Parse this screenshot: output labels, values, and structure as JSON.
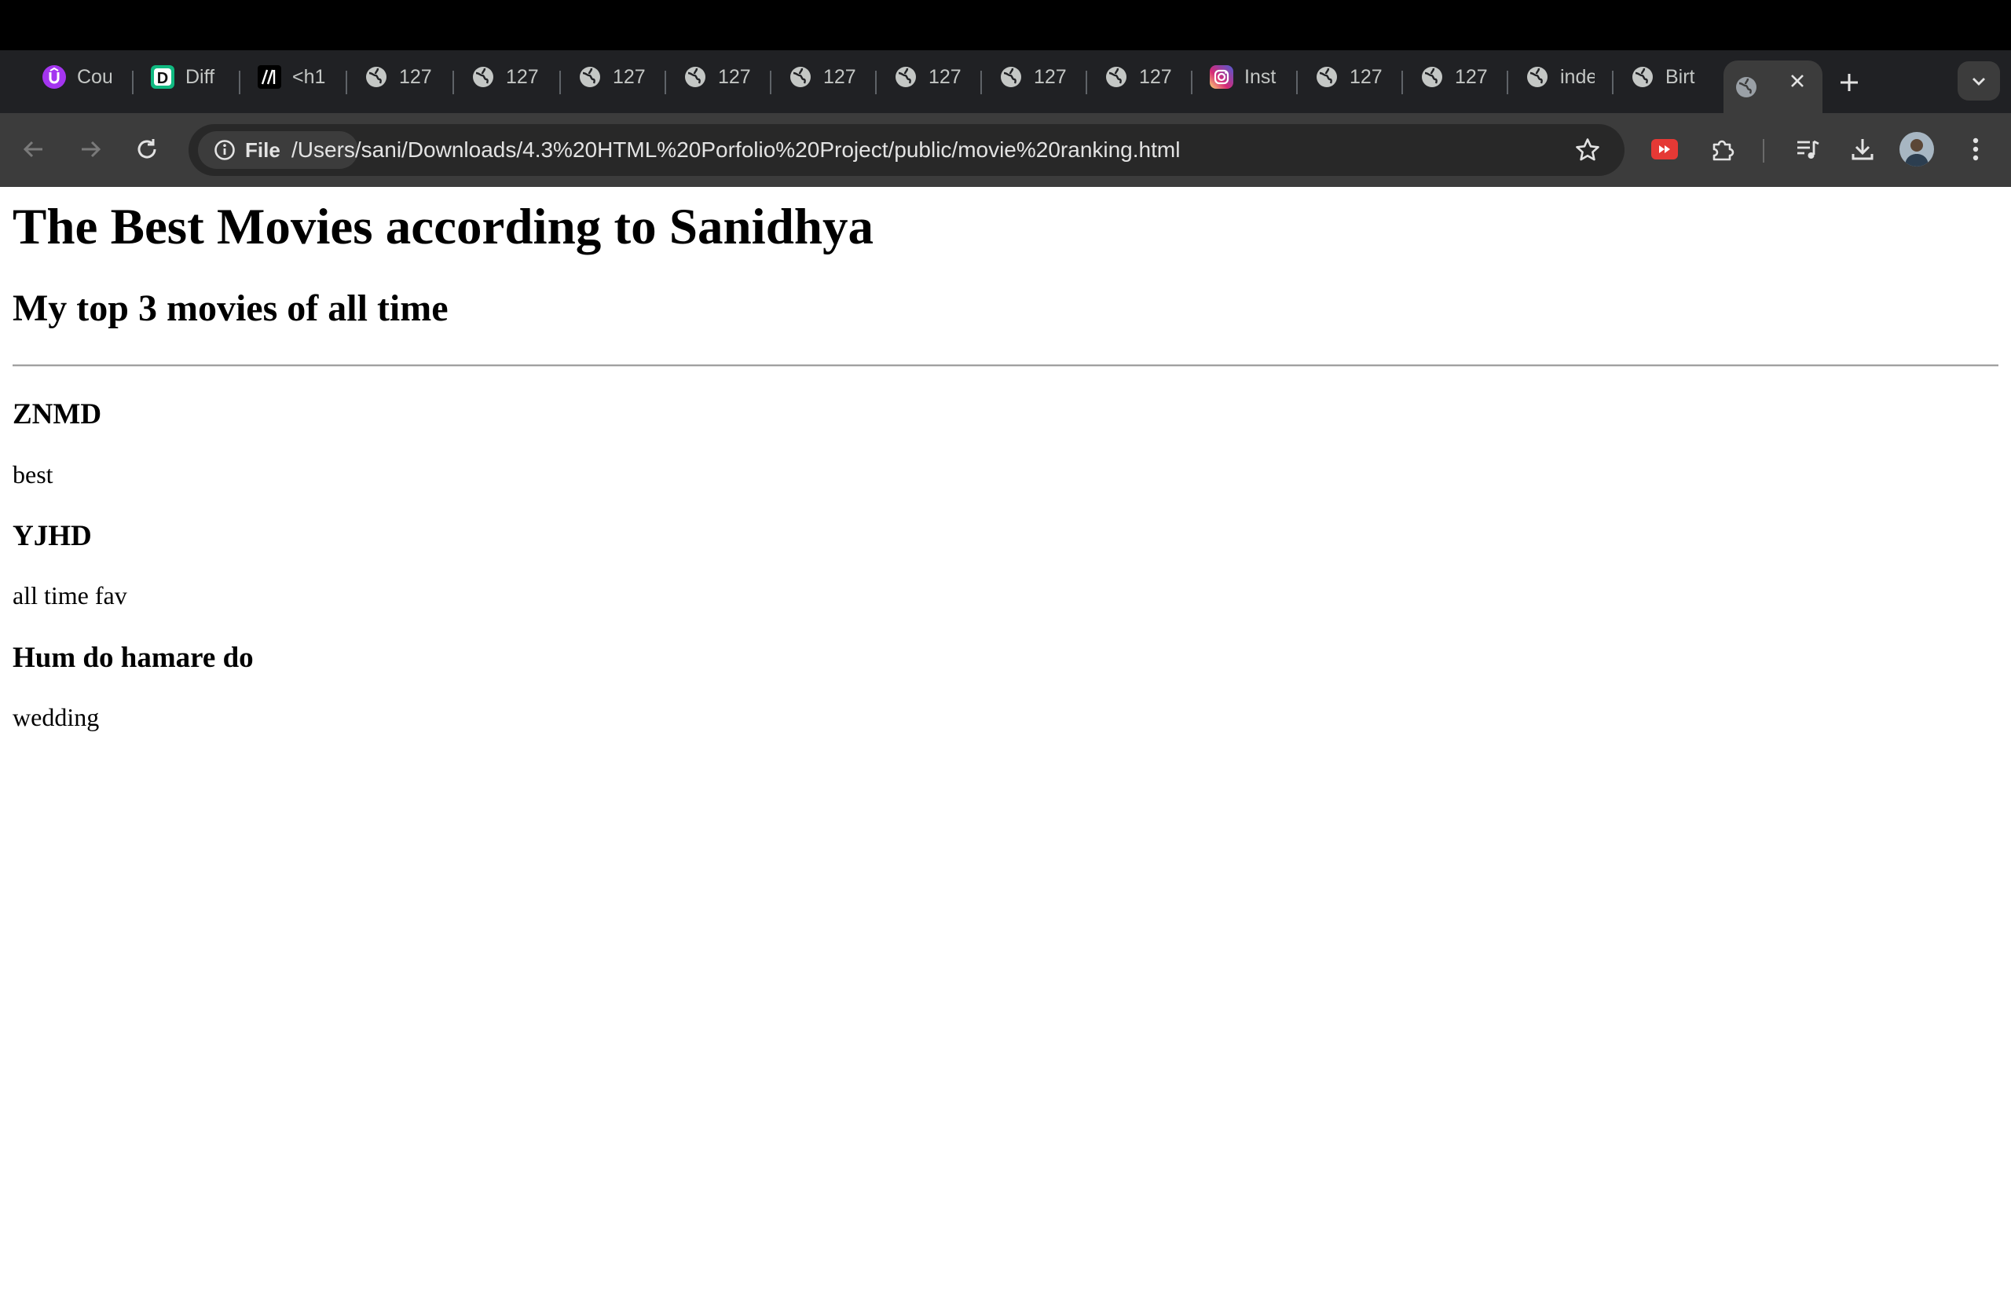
{
  "browser": {
    "tabs": [
      {
        "title": "Cou",
        "icon": "udemy-icon",
        "color": "#a435f0"
      },
      {
        "title": "Diff",
        "icon": "diffchecker-icon",
        "color": "#34d399"
      },
      {
        "title": "<h1",
        "icon": "mdn-icon",
        "color": "#000000"
      },
      {
        "title": "127",
        "icon": "globe-icon"
      },
      {
        "title": "127",
        "icon": "globe-icon"
      },
      {
        "title": "127",
        "icon": "globe-icon"
      },
      {
        "title": "127",
        "icon": "globe-icon"
      },
      {
        "title": "127",
        "icon": "globe-icon"
      },
      {
        "title": "127",
        "icon": "globe-icon"
      },
      {
        "title": "127",
        "icon": "globe-icon"
      },
      {
        "title": "127",
        "icon": "globe-icon"
      },
      {
        "title": "Inst",
        "icon": "instagram-icon"
      },
      {
        "title": "127",
        "icon": "globe-icon"
      },
      {
        "title": "127",
        "icon": "globe-icon"
      },
      {
        "title": "inde",
        "icon": "globe-icon"
      },
      {
        "title": "Birt",
        "icon": "globe-icon"
      }
    ],
    "active_tab": {
      "title": "",
      "icon": "globe-icon"
    },
    "site_chip_label": "File",
    "url": "/Users/sani/Downloads/4.3%20HTML%20Porfolio%20Project/public/movie%20ranking.html"
  },
  "page": {
    "title": "The Best Movies according to Sanidhya",
    "subtitle": "My top 3 movies of all time",
    "movies": [
      {
        "name": "ZNMD",
        "note": "best"
      },
      {
        "name": "YJHD",
        "note": "all time fav"
      },
      {
        "name": "Hum do hamare do",
        "note": "wedding"
      }
    ]
  },
  "colors": {
    "chrome_dark": "#202124",
    "toolbar": "#3c3c3c",
    "omnibox": "#282828",
    "youtube_ext": "#e53935"
  }
}
